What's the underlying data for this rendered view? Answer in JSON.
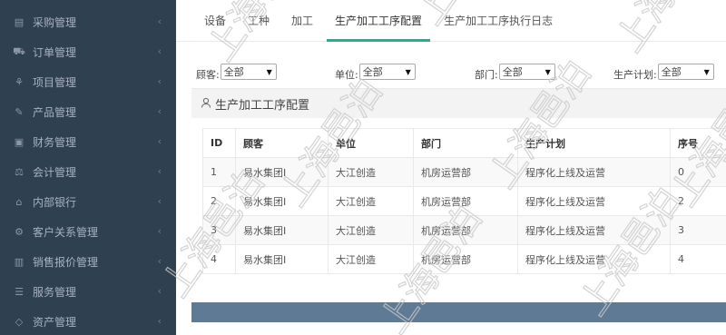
{
  "sidebar": {
    "items": [
      {
        "label": "采购管理",
        "icon": "list-icon",
        "glyph": "▤"
      },
      {
        "label": "订单管理",
        "icon": "cart-icon",
        "glyph": "⛟"
      },
      {
        "label": "项目管理",
        "icon": "cubes-icon",
        "glyph": "⚘"
      },
      {
        "label": "产品管理",
        "icon": "edit-icon",
        "glyph": "✎"
      },
      {
        "label": "财务管理",
        "icon": "money-icon",
        "glyph": "▣"
      },
      {
        "label": "会计管理",
        "icon": "balance-scale-icon",
        "glyph": "⚖"
      },
      {
        "label": "内部银行",
        "icon": "bank-icon",
        "glyph": "⌂"
      },
      {
        "label": "客户关系管理",
        "icon": "cogs-icon",
        "glyph": "⚙"
      },
      {
        "label": "销售报价管理",
        "icon": "bar-chart-icon",
        "glyph": "▥"
      },
      {
        "label": "服务管理",
        "icon": "tasks-icon",
        "glyph": "☰"
      },
      {
        "label": "资产管理",
        "icon": "diamond-icon",
        "glyph": "◇"
      }
    ],
    "chevron": "‹"
  },
  "tabs": [
    {
      "label": "设备"
    },
    {
      "label": "工种"
    },
    {
      "label": "加工"
    },
    {
      "label": "生产加工工序配置",
      "active": true
    },
    {
      "label": "生产加工工序执行日志"
    }
  ],
  "filters": {
    "customer": {
      "label": "顾客:",
      "value": "全部"
    },
    "unit": {
      "label": "单位:",
      "value": "全部"
    },
    "department": {
      "label": "部门:",
      "value": "全部"
    },
    "plan": {
      "label": "生产计划:",
      "value": "全部"
    }
  },
  "panel": {
    "title": "生产加工工序配置",
    "icon": "user-icon"
  },
  "table": {
    "headers": [
      "ID",
      "顾客",
      "单位",
      "部门",
      "生产计划",
      "序号"
    ],
    "rows": [
      [
        "1",
        "易水集团I",
        "大江创造",
        "机房运营部",
        "程序化上线及运营",
        "0"
      ],
      [
        "2",
        "易水集团I",
        "大江创造",
        "机房运营部",
        "程序化上线及运营",
        "2"
      ],
      [
        "3",
        "易水集团I",
        "大江创造",
        "机房运营部",
        "程序化上线及运营",
        "3"
      ],
      [
        "4",
        "易水集团I",
        "大江创造",
        "机房运营部",
        "程序化上线及运营",
        "4"
      ]
    ]
  },
  "watermark": {
    "text": "上海邑泊",
    "color": "#c9c9c9"
  },
  "colors": {
    "sidebar": "#2f4050",
    "accent": "#1ab394",
    "footer": "#5f7a94"
  }
}
